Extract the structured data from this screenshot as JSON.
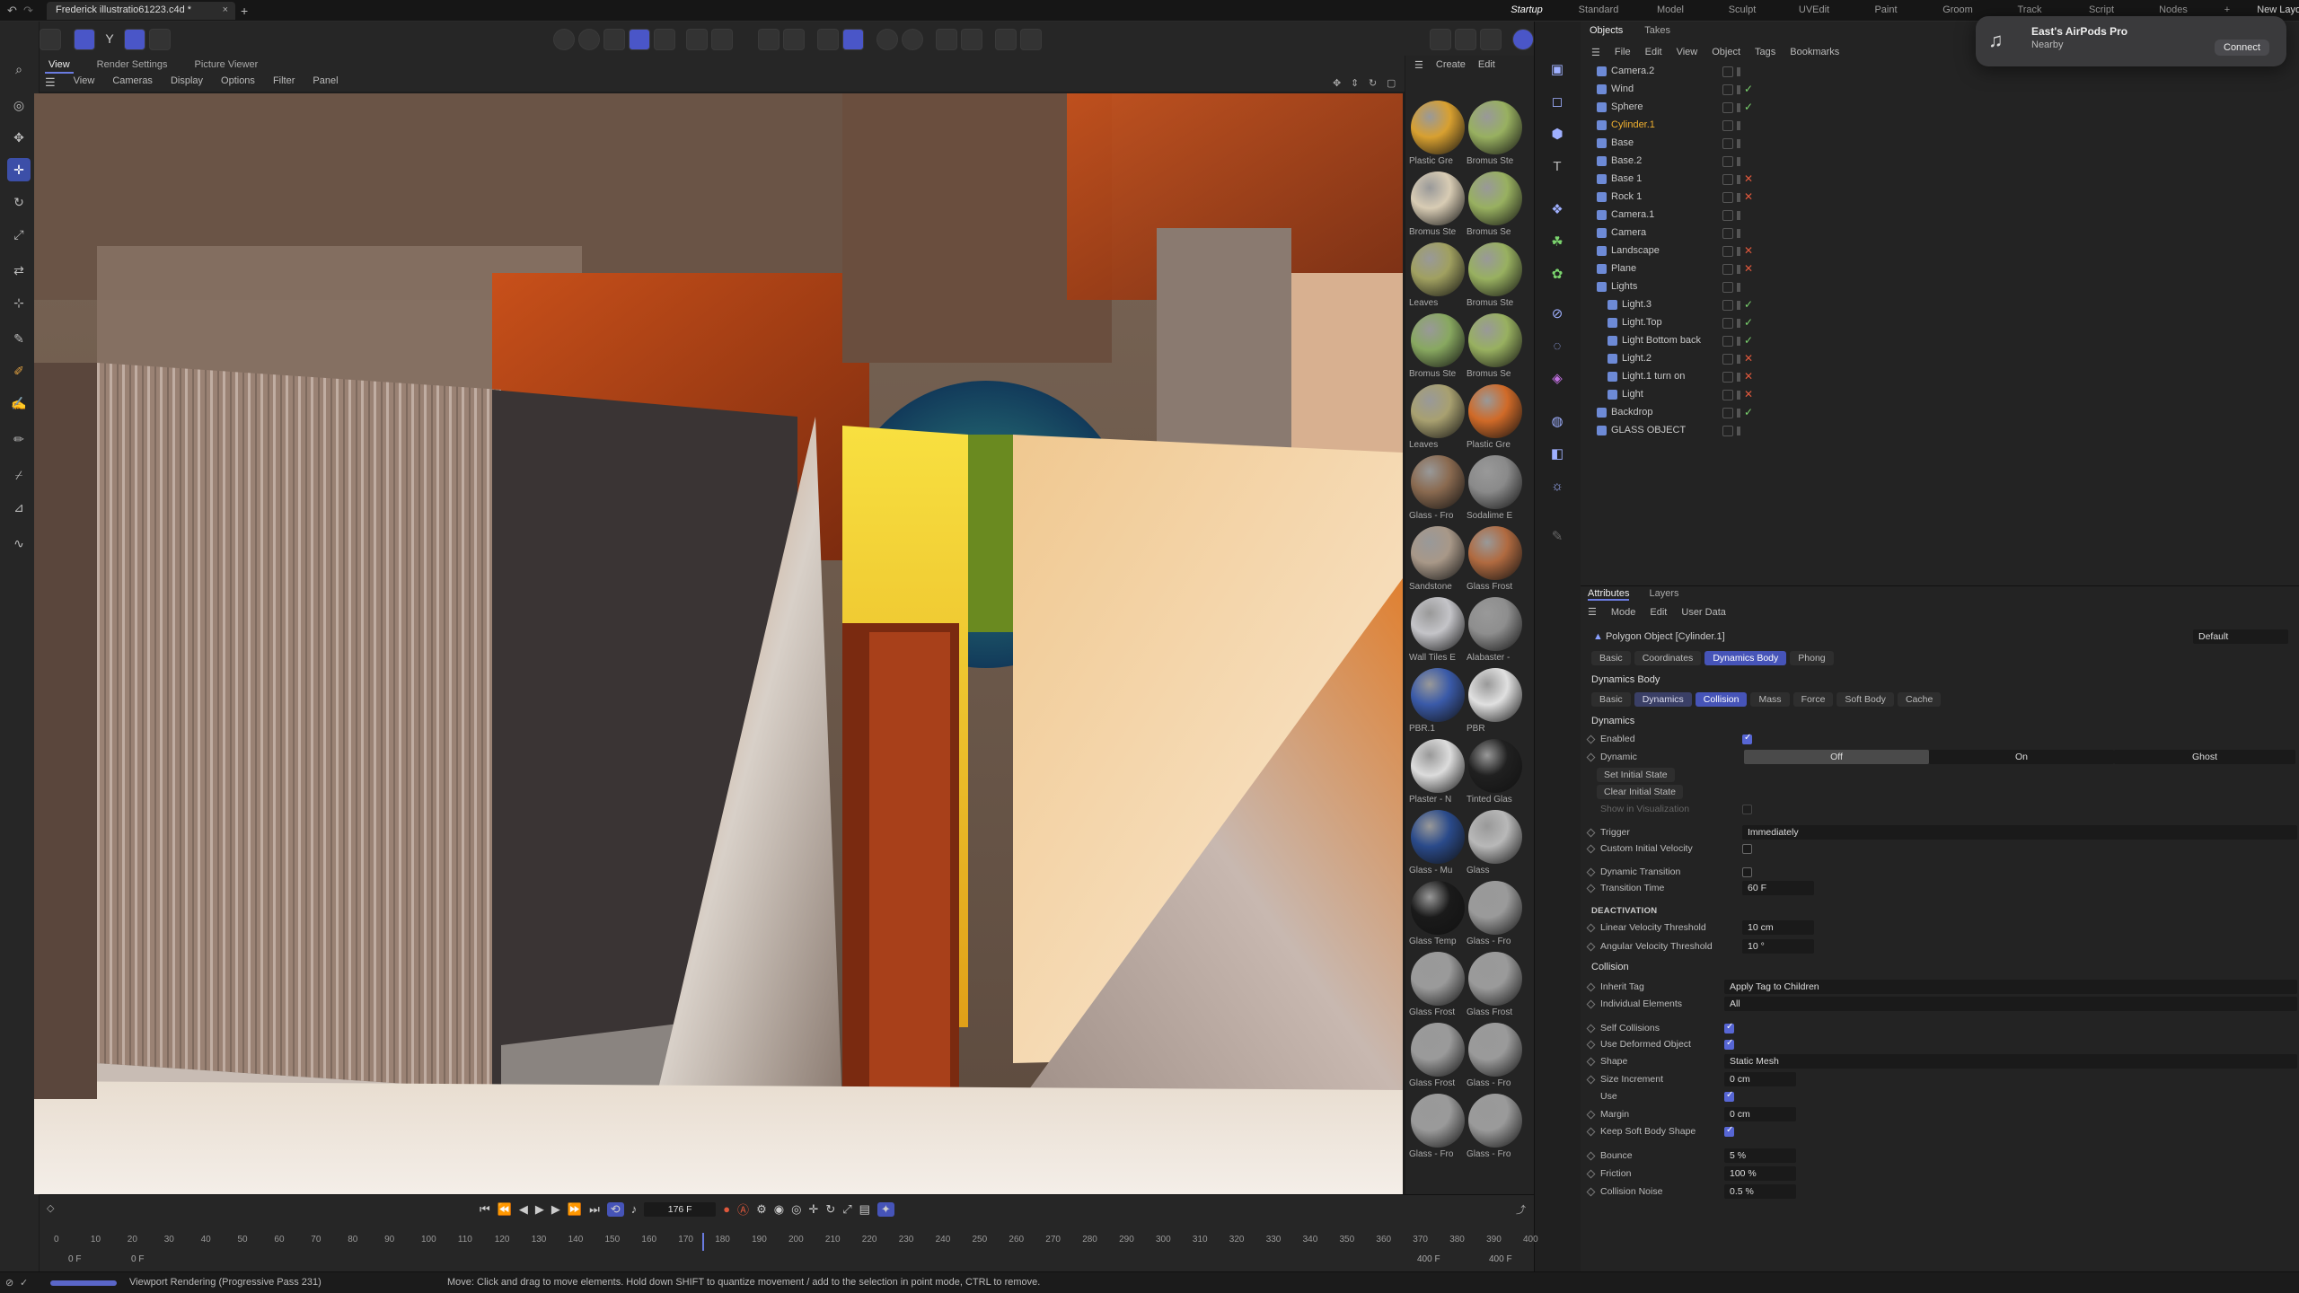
{
  "window": {
    "doc_title": "Frederick illustratio61223.c4d *",
    "close_symbol": "×",
    "new_tab_symbol": "+"
  },
  "layouts": [
    "Startup",
    "Standard",
    "Model",
    "Sculpt",
    "UVEdit",
    "Paint",
    "Groom",
    "Track",
    "Script",
    "Nodes",
    "+",
    "New Layouts"
  ],
  "viewport": {
    "tabs": [
      "View",
      "Render Settings",
      "Picture Viewer"
    ],
    "menu": [
      "View",
      "Cameras",
      "Display",
      "Options",
      "Filter",
      "Panel"
    ]
  },
  "material_menu": [
    "Create",
    "Edit"
  ],
  "materials": [
    {
      "name": "Plastic Gre",
      "color": "#d8a030"
    },
    {
      "name": "Bromus Ste",
      "color": "#98b060"
    },
    {
      "name": "Bromus Ste",
      "color": "#d8ccb4"
    },
    {
      "name": "Bromus Se",
      "color": "#98b060"
    },
    {
      "name": "Leaves",
      "color": "#a0a060"
    },
    {
      "name": "Bromus Ste",
      "color": "#98b060"
    },
    {
      "name": "Bromus Ste",
      "color": "#88a860"
    },
    {
      "name": "Bromus Se",
      "color": "#98b060"
    },
    {
      "name": "Leaves",
      "color": "#a8a070"
    },
    {
      "name": "Plastic Gre",
      "color": "#d06a28"
    },
    {
      "name": "Glass - Fro",
      "color": "#8a6a50"
    },
    {
      "name": "Sodalime E",
      "color": "#8a8a8a"
    },
    {
      "name": "Sandstone",
      "color": "#a89888"
    },
    {
      "name": "Glass Frost",
      "color": "#b06a40"
    },
    {
      "name": "Wall Tiles E",
      "color": "#c4c4c8"
    },
    {
      "name": "Alabaster -",
      "color": "#8e8e8e"
    },
    {
      "name": "PBR.1",
      "color": "#3a5aa8"
    },
    {
      "name": "PBR",
      "color": "#e0e0e0"
    },
    {
      "name": "Plaster - N",
      "color": "#dcdcdc"
    },
    {
      "name": "Tinted Glas",
      "color": "#202020"
    },
    {
      "name": "Glass - Mu",
      "color": "#2a4a8a"
    },
    {
      "name": "Glass",
      "color": "#b8b8b8"
    },
    {
      "name": "Glass Temp",
      "color": "#1a1a1a"
    },
    {
      "name": "Glass - Fro",
      "color": "#9a9a9a"
    },
    {
      "name": "Glass Frost",
      "color": "#9a9a9a"
    },
    {
      "name": "Glass Frost",
      "color": "#9a9a9a"
    },
    {
      "name": "Glass Frost",
      "color": "#9a9a9a"
    },
    {
      "name": "Glass - Fro",
      "color": "#9a9a9a"
    },
    {
      "name": "Glass - Fro",
      "color": "#9a9a9a"
    },
    {
      "name": "Glass - Fro",
      "color": "#9a9a9a"
    }
  ],
  "objects": {
    "tabs": [
      "Objects",
      "Takes"
    ],
    "menu": [
      "File",
      "Edit",
      "View",
      "Object",
      "Tags",
      "Bookmarks"
    ],
    "rows": [
      {
        "name": "Camera.2",
        "indent": 0,
        "status": "",
        "highlight": false
      },
      {
        "name": "Wind",
        "indent": 0,
        "status": "✓",
        "highlight": false
      },
      {
        "name": "Sphere",
        "indent": 0,
        "status": "✓",
        "highlight": false
      },
      {
        "name": "Cylinder.1",
        "indent": 0,
        "status": "",
        "highlight": true
      },
      {
        "name": "Base",
        "indent": 0,
        "status": "",
        "highlight": false
      },
      {
        "name": "Base.2",
        "indent": 0,
        "status": "",
        "highlight": false
      },
      {
        "name": "Base 1",
        "indent": 0,
        "status": "✕",
        "highlight": false
      },
      {
        "name": "Rock 1",
        "indent": 0,
        "status": "✕",
        "highlight": false
      },
      {
        "name": "Camera.1",
        "indent": 0,
        "status": "",
        "highlight": false
      },
      {
        "name": "Camera",
        "indent": 0,
        "status": "",
        "highlight": false
      },
      {
        "name": "Landscape",
        "indent": 0,
        "status": "✕",
        "highlight": false
      },
      {
        "name": "Plane",
        "indent": 0,
        "status": "✕",
        "highlight": false
      },
      {
        "name": "Lights",
        "indent": 0,
        "status": "",
        "highlight": false
      },
      {
        "name": "Light.3",
        "indent": 1,
        "status": "✓",
        "highlight": false
      },
      {
        "name": "Light.Top",
        "indent": 1,
        "status": "✓",
        "highlight": false
      },
      {
        "name": "Light Bottom back",
        "indent": 1,
        "status": "✓",
        "highlight": false
      },
      {
        "name": "Light.2",
        "indent": 1,
        "status": "✕",
        "highlight": false
      },
      {
        "name": "Light.1 turn on",
        "indent": 1,
        "status": "✕",
        "highlight": false
      },
      {
        "name": "Light",
        "indent": 1,
        "status": "✕",
        "highlight": false
      },
      {
        "name": "Backdrop",
        "indent": 0,
        "status": "✓",
        "highlight": false
      },
      {
        "name": "GLASS OBJECT",
        "indent": 0,
        "status": "",
        "highlight": false
      }
    ]
  },
  "attributes": {
    "tabs": [
      "Attributes",
      "Layers"
    ],
    "menu": [
      "Mode",
      "Edit",
      "User Data"
    ],
    "object_label": "Polygon Object [Cylinder.1]",
    "preset": "Default",
    "top_tabs": [
      "Basic",
      "Coordinates",
      "Dynamics Body",
      "Phong"
    ],
    "section_title": "Dynamics Body",
    "sub_tabs": [
      "Basic",
      "Dynamics",
      "Collision",
      "Mass",
      "Force",
      "Soft Body",
      "Cache"
    ],
    "dynamics_head": "Dynamics",
    "enabled_label": "Enabled",
    "dynamic_label": "Dynamic",
    "dynamic_options": [
      "Off",
      "On",
      "Ghost"
    ],
    "set_initial": "Set Initial State",
    "clear_initial": "Clear Initial State",
    "show_vis": "Show in Visualization",
    "trigger_label": "Trigger",
    "trigger_value": "Immediately",
    "civ_label": "Custom Initial Velocity",
    "dyn_trans_label": "Dynamic Transition",
    "trans_time_label": "Transition Time",
    "trans_time_value": "60 F",
    "deact_head": "DEACTIVATION",
    "lvt_label": "Linear Velocity Threshold",
    "lvt_value": "10 cm",
    "avt_label": "Angular Velocity Threshold",
    "avt_value": "10 °",
    "collision_head": "Collision",
    "inherit_label": "Inherit Tag",
    "inherit_value": "Apply Tag to Children",
    "indiv_label": "Individual Elements",
    "indiv_value": "All",
    "self_label": "Self Collisions",
    "deformed_label": "Use Deformed Object",
    "shape_label": "Shape",
    "shape_value": "Static Mesh",
    "size_inc_label": "Size Increment",
    "size_inc_value": "0 cm",
    "use_label": "Use",
    "margin_label": "Margin",
    "margin_value": "0 cm",
    "keep_label": "Keep Soft Body Shape",
    "bounce_label": "Bounce",
    "bounce_value": "5 %",
    "friction_label": "Friction",
    "friction_value": "100 %",
    "noise_label": "Collision Noise",
    "noise_value": "0.5 %"
  },
  "timeline": {
    "current_frame": "176 F",
    "ticks": [
      "0",
      "10",
      "20",
      "30",
      "40",
      "50",
      "60",
      "70",
      "80",
      "90",
      "100",
      "110",
      "120",
      "130",
      "140",
      "150",
      "160",
      "170",
      "180",
      "190",
      "200",
      "210",
      "220",
      "230",
      "240",
      "250",
      "260",
      "270",
      "280",
      "290",
      "300",
      "310",
      "320",
      "330",
      "340",
      "350",
      "360",
      "370",
      "380",
      "390",
      "400"
    ],
    "start_a": "0 F",
    "start_b": "0 F",
    "end_a": "400 F",
    "end_b": "400 F"
  },
  "status": {
    "left": "Viewport Rendering (Progressive Pass 231)",
    "hint": "Move: Click and drag to move elements. Hold down SHIFT to quantize movement / add to the selection in point mode, CTRL to remove."
  },
  "notification": {
    "title": "East's AirPods Pro",
    "subtitle": "Nearby",
    "action": "Connect"
  }
}
